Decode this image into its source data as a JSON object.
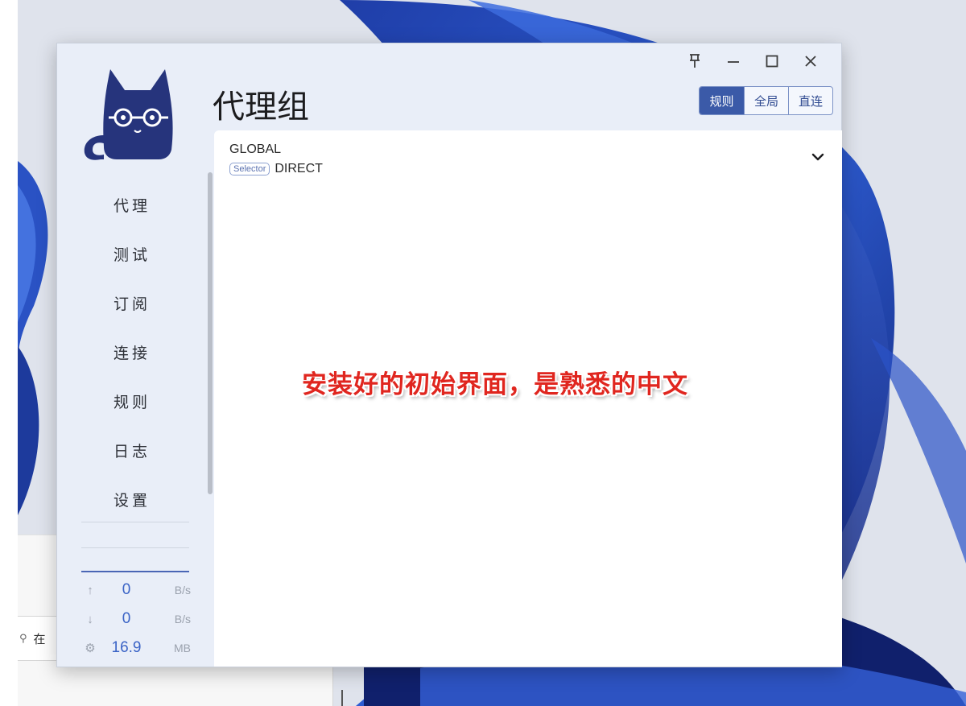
{
  "window": {
    "title": "代理组",
    "controls": [
      "pin-icon",
      "minimize-icon",
      "maximize-icon",
      "close-icon"
    ]
  },
  "modes": [
    {
      "label": "规则",
      "active": true
    },
    {
      "label": "全局",
      "active": false
    },
    {
      "label": "直连",
      "active": false
    }
  ],
  "nav": [
    {
      "label": "代理",
      "active": true
    },
    {
      "label": "测试",
      "active": false
    },
    {
      "label": "订阅",
      "active": false
    },
    {
      "label": "连接",
      "active": false
    },
    {
      "label": "规则",
      "active": false
    },
    {
      "label": "日志",
      "active": false
    },
    {
      "label": "设置",
      "active": false
    }
  ],
  "traffic": {
    "upload": {
      "icon": "arrow-up-icon",
      "value": "0",
      "unit": "B/s"
    },
    "download": {
      "icon": "arrow-down-icon",
      "value": "0",
      "unit": "B/s"
    },
    "memory": {
      "icon": "gear-icon",
      "value": "16.9",
      "unit": "MB"
    }
  },
  "proxy_group": {
    "name": "GLOBAL",
    "type_badge": "Selector",
    "current": "DIRECT"
  },
  "caption": "安装好的初始界面，是熟悉的中文",
  "background_window": {
    "search_text": "在"
  },
  "colors": {
    "accent": "#3b5aa8",
    "sidebar_bg": "#e9eef8",
    "active_nav_bg": "#c9d6ee",
    "caption": "#e0261f"
  }
}
